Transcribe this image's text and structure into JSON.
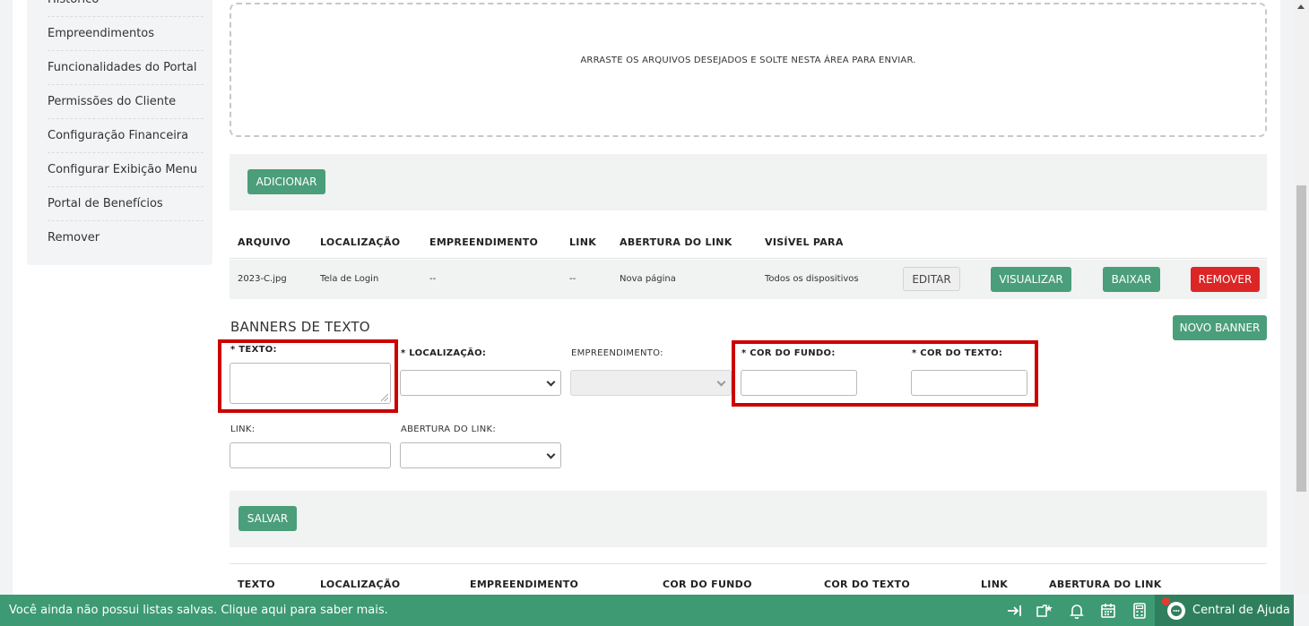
{
  "sidebar": {
    "items": [
      {
        "label": "Histórico"
      },
      {
        "label": "Empreendimentos"
      },
      {
        "label": "Funcionalidades do Portal"
      },
      {
        "label": "Permissões do Cliente"
      },
      {
        "label": "Configuração Financeira"
      },
      {
        "label": "Configurar Exibição Menu"
      },
      {
        "label": "Portal de Benefícios"
      },
      {
        "label": "Remover"
      }
    ]
  },
  "upload": {
    "dropzone_text": "ARRASTE OS ARQUIVOS DESEJADOS E SOLTE NESTA ÁREA PARA ENVIAR.",
    "add_button": "ADICIONAR"
  },
  "files_table": {
    "headers": [
      "ARQUIVO",
      "LOCALIZAÇÃO",
      "EMPREENDIMENTO",
      "LINK",
      "ABERTURA DO LINK",
      "VISÍVEL PARA"
    ],
    "rows": [
      {
        "arquivo": "2023-C.jpg",
        "localizacao": "Tela de Login",
        "empreendimento": "--",
        "link": "--",
        "abertura": "Nova página",
        "visivel": "Todos os dispositivos"
      }
    ],
    "actions": {
      "edit": "EDITAR",
      "view": "VISUALIZAR",
      "download": "BAIXAR",
      "remove": "REMOVER"
    }
  },
  "text_banners": {
    "title": "BANNERS DE TEXTO",
    "new_button": "NOVO BANNER",
    "form": {
      "texto_label": "* TEXTO:",
      "localizacao_label": "* LOCALIZAÇÃO:",
      "empreendimento_label": "EMPREENDIMENTO:",
      "cor_fundo_label": "* COR DO FUNDO:",
      "cor_texto_label": "* COR DO TEXTO:",
      "link_label": "LINK:",
      "abertura_label": "ABERTURA DO LINK:"
    },
    "save_button": "SALVAR",
    "table_headers": [
      "TEXTO",
      "LOCALIZAÇÃO",
      "EMPREENDIMENTO",
      "COR DO FUNDO",
      "COR DO TEXTO",
      "LINK",
      "ABERTURA DO LINK"
    ]
  },
  "bottom_bar": {
    "message": "Você ainda não possui listas salvas. Clique aqui para saber mais.",
    "icons": [
      "collapse-icon",
      "favorite-folder-icon",
      "bell-icon",
      "calendar-icon",
      "calculator-icon"
    ],
    "help_label": "Central de Ajuda"
  },
  "colors": {
    "green": "#4a9e79",
    "red": "#dc2626",
    "bar": "#3d9a72",
    "highlight": "#cc0000"
  }
}
